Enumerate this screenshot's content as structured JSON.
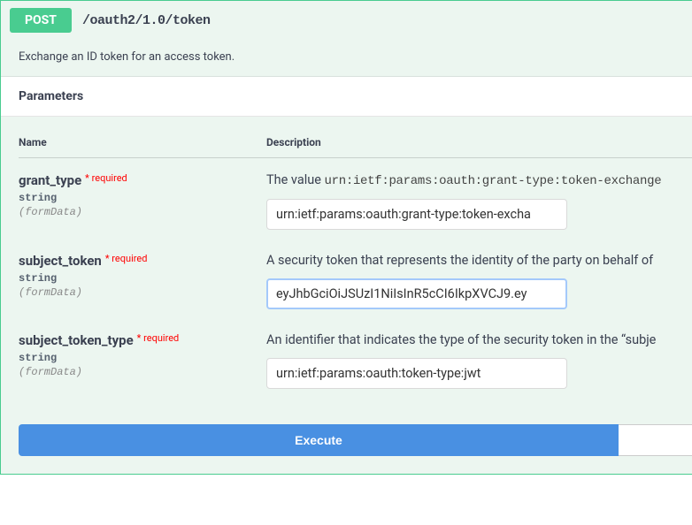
{
  "method": "POST",
  "path": "/oauth2/1.0/token",
  "description": "Exchange an ID token for an access token.",
  "sections": {
    "parameters_title": "Parameters"
  },
  "table_headers": {
    "name": "Name",
    "description": "Description"
  },
  "params": [
    {
      "name": "grant_type",
      "required_label": "* required",
      "type": "string",
      "in": "(formData)",
      "desc_prefix": "The value ",
      "desc_code": "urn:ietf:params:oauth:grant-type:token-exchange",
      "value": "urn:ietf:params:oauth:grant-type:token-excha",
      "focused": false
    },
    {
      "name": "subject_token",
      "required_label": "* required",
      "type": "string",
      "in": "(formData)",
      "desc_prefix": "A security token that represents the identity of the party on behalf of ",
      "desc_code": "",
      "value": "eyJhbGciOiJSUzI1NiIsInR5cCI6IkpXVCJ9.ey",
      "focused": true
    },
    {
      "name": "subject_token_type",
      "required_label": "* required",
      "type": "string",
      "in": "(formData)",
      "desc_prefix": "An identifier that indicates the type of the security token in the “subje",
      "desc_code": "",
      "value": "urn:ietf:params:oauth:token-type:jwt",
      "focused": false
    }
  ],
  "buttons": {
    "execute": "Execute"
  }
}
